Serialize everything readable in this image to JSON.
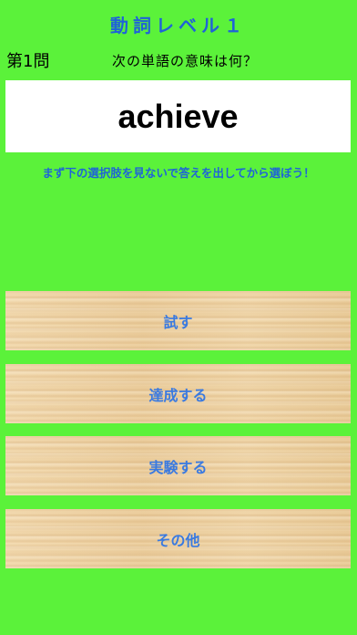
{
  "header": {
    "title": "動詞レベル１",
    "question_number": "第1問",
    "prompt": "次の単語の意味は何？"
  },
  "question": {
    "word": "achieve"
  },
  "hint": "まず下の選択肢を見ないで答えを出してから選ぼう！",
  "choices": [
    {
      "label": "試す"
    },
    {
      "label": "達成する"
    },
    {
      "label": "実験する"
    },
    {
      "label": "その他"
    }
  ],
  "colors": {
    "background": "#5bf23a",
    "accent": "#1f63d8",
    "choice_text": "#3a7ae0"
  }
}
